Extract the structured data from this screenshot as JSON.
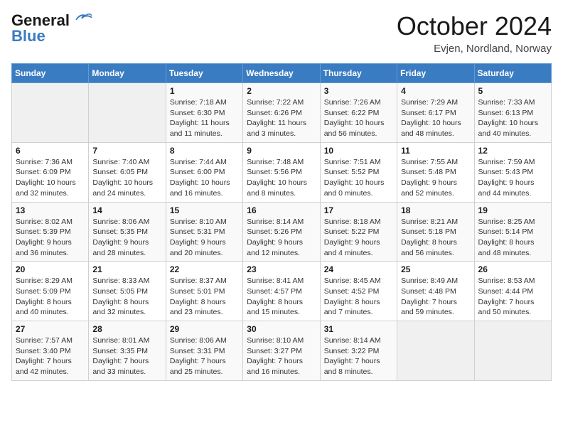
{
  "logo": {
    "line1": "General",
    "line2": "Blue"
  },
  "title": "October 2024",
  "subtitle": "Evjen, Nordland, Norway",
  "days_of_week": [
    "Sunday",
    "Monday",
    "Tuesday",
    "Wednesday",
    "Thursday",
    "Friday",
    "Saturday"
  ],
  "weeks": [
    [
      {
        "day": "",
        "details": ""
      },
      {
        "day": "",
        "details": ""
      },
      {
        "day": "1",
        "details": "Sunrise: 7:18 AM\nSunset: 6:30 PM\nDaylight: 11 hours\nand 11 minutes."
      },
      {
        "day": "2",
        "details": "Sunrise: 7:22 AM\nSunset: 6:26 PM\nDaylight: 11 hours\nand 3 minutes."
      },
      {
        "day": "3",
        "details": "Sunrise: 7:26 AM\nSunset: 6:22 PM\nDaylight: 10 hours\nand 56 minutes."
      },
      {
        "day": "4",
        "details": "Sunrise: 7:29 AM\nSunset: 6:17 PM\nDaylight: 10 hours\nand 48 minutes."
      },
      {
        "day": "5",
        "details": "Sunrise: 7:33 AM\nSunset: 6:13 PM\nDaylight: 10 hours\nand 40 minutes."
      }
    ],
    [
      {
        "day": "6",
        "details": "Sunrise: 7:36 AM\nSunset: 6:09 PM\nDaylight: 10 hours\nand 32 minutes."
      },
      {
        "day": "7",
        "details": "Sunrise: 7:40 AM\nSunset: 6:05 PM\nDaylight: 10 hours\nand 24 minutes."
      },
      {
        "day": "8",
        "details": "Sunrise: 7:44 AM\nSunset: 6:00 PM\nDaylight: 10 hours\nand 16 minutes."
      },
      {
        "day": "9",
        "details": "Sunrise: 7:48 AM\nSunset: 5:56 PM\nDaylight: 10 hours\nand 8 minutes."
      },
      {
        "day": "10",
        "details": "Sunrise: 7:51 AM\nSunset: 5:52 PM\nDaylight: 10 hours\nand 0 minutes."
      },
      {
        "day": "11",
        "details": "Sunrise: 7:55 AM\nSunset: 5:48 PM\nDaylight: 9 hours\nand 52 minutes."
      },
      {
        "day": "12",
        "details": "Sunrise: 7:59 AM\nSunset: 5:43 PM\nDaylight: 9 hours\nand 44 minutes."
      }
    ],
    [
      {
        "day": "13",
        "details": "Sunrise: 8:02 AM\nSunset: 5:39 PM\nDaylight: 9 hours\nand 36 minutes."
      },
      {
        "day": "14",
        "details": "Sunrise: 8:06 AM\nSunset: 5:35 PM\nDaylight: 9 hours\nand 28 minutes."
      },
      {
        "day": "15",
        "details": "Sunrise: 8:10 AM\nSunset: 5:31 PM\nDaylight: 9 hours\nand 20 minutes."
      },
      {
        "day": "16",
        "details": "Sunrise: 8:14 AM\nSunset: 5:26 PM\nDaylight: 9 hours\nand 12 minutes."
      },
      {
        "day": "17",
        "details": "Sunrise: 8:18 AM\nSunset: 5:22 PM\nDaylight: 9 hours\nand 4 minutes."
      },
      {
        "day": "18",
        "details": "Sunrise: 8:21 AM\nSunset: 5:18 PM\nDaylight: 8 hours\nand 56 minutes."
      },
      {
        "day": "19",
        "details": "Sunrise: 8:25 AM\nSunset: 5:14 PM\nDaylight: 8 hours\nand 48 minutes."
      }
    ],
    [
      {
        "day": "20",
        "details": "Sunrise: 8:29 AM\nSunset: 5:09 PM\nDaylight: 8 hours\nand 40 minutes."
      },
      {
        "day": "21",
        "details": "Sunrise: 8:33 AM\nSunset: 5:05 PM\nDaylight: 8 hours\nand 32 minutes."
      },
      {
        "day": "22",
        "details": "Sunrise: 8:37 AM\nSunset: 5:01 PM\nDaylight: 8 hours\nand 23 minutes."
      },
      {
        "day": "23",
        "details": "Sunrise: 8:41 AM\nSunset: 4:57 PM\nDaylight: 8 hours\nand 15 minutes."
      },
      {
        "day": "24",
        "details": "Sunrise: 8:45 AM\nSunset: 4:52 PM\nDaylight: 8 hours\nand 7 minutes."
      },
      {
        "day": "25",
        "details": "Sunrise: 8:49 AM\nSunset: 4:48 PM\nDaylight: 7 hours\nand 59 minutes."
      },
      {
        "day": "26",
        "details": "Sunrise: 8:53 AM\nSunset: 4:44 PM\nDaylight: 7 hours\nand 50 minutes."
      }
    ],
    [
      {
        "day": "27",
        "details": "Sunrise: 7:57 AM\nSunset: 3:40 PM\nDaylight: 7 hours\nand 42 minutes."
      },
      {
        "day": "28",
        "details": "Sunrise: 8:01 AM\nSunset: 3:35 PM\nDaylight: 7 hours\nand 33 minutes."
      },
      {
        "day": "29",
        "details": "Sunrise: 8:06 AM\nSunset: 3:31 PM\nDaylight: 7 hours\nand 25 minutes."
      },
      {
        "day": "30",
        "details": "Sunrise: 8:10 AM\nSunset: 3:27 PM\nDaylight: 7 hours\nand 16 minutes."
      },
      {
        "day": "31",
        "details": "Sunrise: 8:14 AM\nSunset: 3:22 PM\nDaylight: 7 hours\nand 8 minutes."
      },
      {
        "day": "",
        "details": ""
      },
      {
        "day": "",
        "details": ""
      }
    ]
  ]
}
